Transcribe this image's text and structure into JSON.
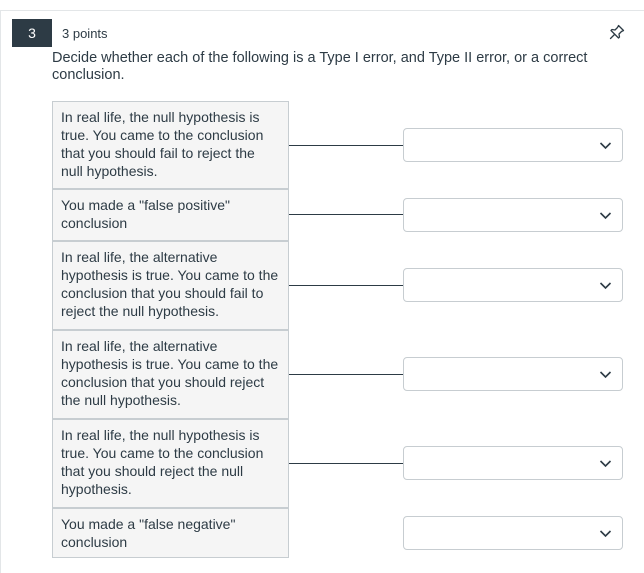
{
  "question": {
    "number": "3",
    "points": "3 points",
    "prompt": "Decide whether each of the following is a Type I error, and Type II error, or a correct conclusion."
  },
  "icons": {
    "pin": "pin-icon",
    "select_caret": "chevron-down-icon"
  },
  "colors": {
    "question_number_bg": "#2d3b45",
    "text": "#2d3b45",
    "label_bg": "#f5f5f5",
    "border": "#c7cdd1"
  },
  "matches": [
    {
      "label": "In real life, the null hypothesis is true. You came to the conclusion that you should fail to reject the null hypothesis.",
      "selected": ""
    },
    {
      "label": "You made a \"false positive\" conclusion",
      "selected": ""
    },
    {
      "label": "In real life, the alternative hypothesis is true. You came to the conclusion that you should fail to reject the null hypothesis.",
      "selected": ""
    },
    {
      "label": "In real life, the alternative hypothesis is true. You came to the conclusion that you should reject the null hypothesis.",
      "selected": ""
    },
    {
      "label": "In real life, the null hypothesis is true. You came to the conclusion that you should reject the null hypothesis.",
      "selected": ""
    },
    {
      "label": "You made a \"false negative\" conclusion",
      "selected": ""
    }
  ]
}
